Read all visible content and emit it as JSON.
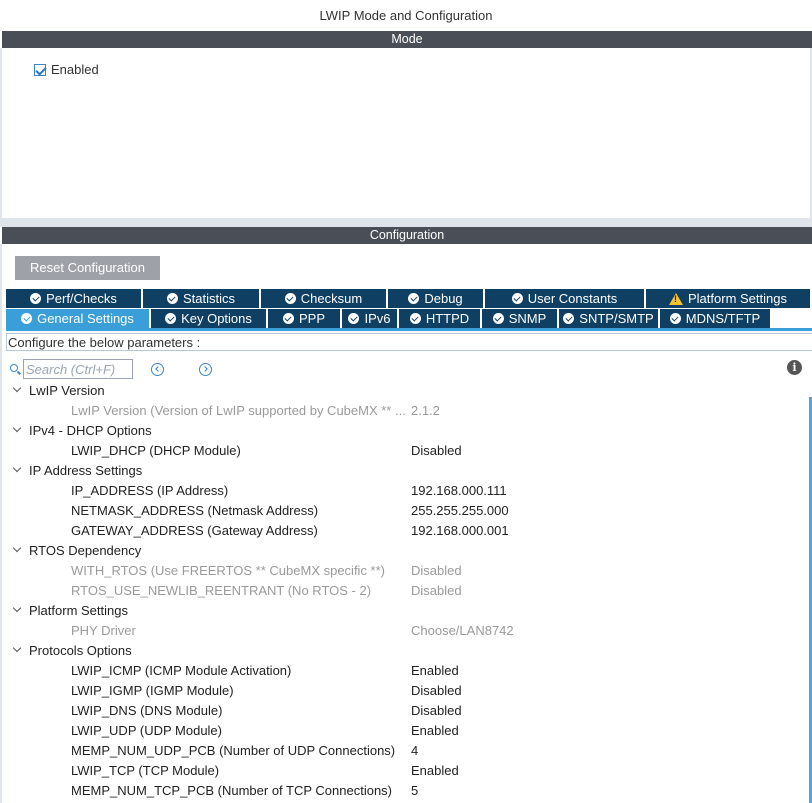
{
  "window_title": "LWIP Mode and Configuration",
  "mode": {
    "header": "Mode",
    "enabled_label": "Enabled",
    "enabled_checked": true
  },
  "configuration": {
    "header": "Configuration",
    "reset_label": "Reset Configuration",
    "tabs_row1": [
      {
        "label": "Perf/Checks",
        "icon": "check-icon"
      },
      {
        "label": "Statistics",
        "icon": "check-icon"
      },
      {
        "label": "Checksum",
        "icon": "check-icon"
      },
      {
        "label": "Debug",
        "icon": "check-icon"
      },
      {
        "label": "User Constants",
        "icon": "check-icon"
      },
      {
        "label": "Platform Settings",
        "icon": "warning-icon"
      }
    ],
    "tabs_row2": [
      {
        "label": "General Settings",
        "icon": "check-icon",
        "active": true
      },
      {
        "label": "Key Options",
        "icon": "check-icon"
      },
      {
        "label": "PPP",
        "icon": "check-icon"
      },
      {
        "label": "IPv6",
        "icon": "check-icon"
      },
      {
        "label": "HTTPD",
        "icon": "check-icon"
      },
      {
        "label": "SNMP",
        "icon": "check-icon"
      },
      {
        "label": "SNTP/SMTP",
        "icon": "check-icon"
      },
      {
        "label": "MDNS/TFTP",
        "icon": "check-icon"
      }
    ],
    "configure_text": "Configure the below parameters :",
    "search_placeholder": "Search (Ctrl+F)",
    "groups": [
      {
        "label": "LwIP Version",
        "params": [
          {
            "name": "LwIP Version (Version of LwIP supported by CubeMX ** ...",
            "value": "2.1.2",
            "disabled": true
          }
        ]
      },
      {
        "label": "IPv4 - DHCP Options",
        "params": [
          {
            "name": "LWIP_DHCP (DHCP Module)",
            "value": "Disabled",
            "disabled": false
          }
        ]
      },
      {
        "label": "IP Address Settings",
        "params": [
          {
            "name": "IP_ADDRESS (IP Address)",
            "value": "192.168.000.111",
            "disabled": false
          },
          {
            "name": "NETMASK_ADDRESS (Netmask Address)",
            "value": "255.255.255.000",
            "disabled": false
          },
          {
            "name": "GATEWAY_ADDRESS (Gateway Address)",
            "value": "192.168.000.001",
            "disabled": false
          }
        ]
      },
      {
        "label": "RTOS Dependency",
        "params": [
          {
            "name": "WITH_RTOS (Use FREERTOS ** CubeMX specific **)",
            "value": "Disabled",
            "disabled": true
          },
          {
            "name": "RTOS_USE_NEWLIB_REENTRANT (No RTOS - 2)",
            "value": "Disabled",
            "disabled": true
          }
        ]
      },
      {
        "label": "Platform Settings",
        "params": [
          {
            "name": "PHY Driver",
            "value": "Choose/LAN8742",
            "disabled": true
          }
        ]
      },
      {
        "label": "Protocols Options",
        "params": [
          {
            "name": "LWIP_ICMP (ICMP Module Activation)",
            "value": "Enabled",
            "disabled": false
          },
          {
            "name": "LWIP_IGMP (IGMP Module)",
            "value": "Disabled",
            "disabled": false
          },
          {
            "name": "LWIP_DNS (DNS Module)",
            "value": "Disabled",
            "disabled": false
          },
          {
            "name": "LWIP_UDP (UDP Module)",
            "value": "Enabled",
            "disabled": false
          },
          {
            "name": "MEMP_NUM_UDP_PCB (Number of UDP Connections)",
            "value": "4",
            "disabled": false
          },
          {
            "name": "LWIP_TCP (TCP Module)",
            "value": "Enabled",
            "disabled": false
          },
          {
            "name": "MEMP_NUM_TCP_PCB (Number of TCP Connections)",
            "value": "5",
            "disabled": false
          }
        ]
      }
    ]
  },
  "colors": {
    "section_bar": "#4a4f57",
    "tab_dark": "#0f3f62",
    "tab_active": "#3a9fd8",
    "reset_button": "#9ea2a8",
    "disabled_text": "#9a9a9a",
    "warning": "#f2c230"
  }
}
